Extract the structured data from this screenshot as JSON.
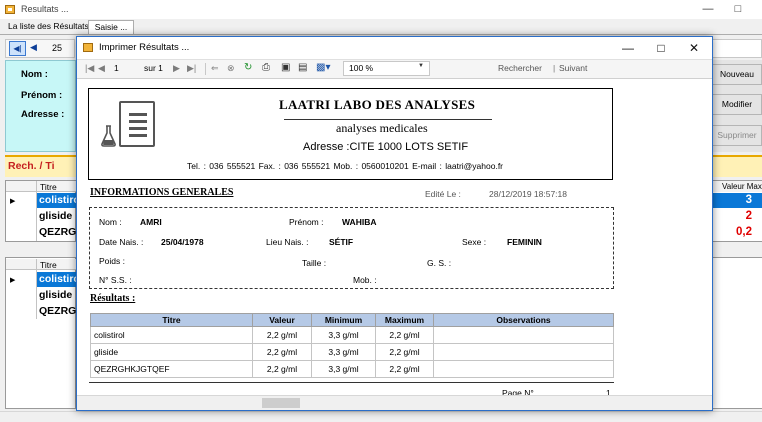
{
  "main_window": {
    "title": "Resultats ...",
    "tabs": [
      {
        "label": "La liste des Résultats"
      },
      {
        "label": "Saisie ..."
      }
    ],
    "navigator": {
      "position": "25"
    },
    "labels": {
      "nom": "Nom :",
      "prenom": "Prénom :",
      "adresse": "Adresse :"
    },
    "buttons": {
      "nouveau": "Nouveau",
      "modifier": "Modifier",
      "supprimer": "Supprimer"
    },
    "search_label": "Rech. / Ti",
    "grid1": {
      "header": "Titre",
      "rows": [
        "colistirol",
        "gliside",
        "QEZRGHKJGTQEF"
      ]
    },
    "grid_right": {
      "header": "Valeur Max",
      "values": [
        "3",
        "2",
        "0,2"
      ]
    },
    "grid2": {
      "header": "Titre",
      "rows": [
        "colistirol",
        "gliside",
        "QEZRGHKJGTQEF"
      ]
    }
  },
  "dialog": {
    "title": "Imprimer Résultats ...",
    "toolbar": {
      "page": "1",
      "of_label": "sur 1",
      "zoom": "100 %",
      "find_label": "Rechercher",
      "next_label": "Suivant"
    },
    "report": {
      "lab_name": "LAATRI LABO DES ANALYSES",
      "subtitle": "analyses medicales",
      "address": "Adresse :CITE 1000 LOTS SETIF",
      "contact": "Tel. :  036 555521 Fax. :  036 555521  Mob. : 0560010201  E-mail : laatri@yahoo.fr",
      "section_info": "INFORMATIONS GENERALES",
      "edited_label": "Edité Le :",
      "edited_value": "28/12/2019  18:57:18",
      "patient": {
        "nom_label": "Nom :",
        "nom": "AMRI",
        "prenom_label": "Prénom :",
        "prenom": "WAHIBA",
        "date_label": "Date Nais. :",
        "date": "25/04/1978",
        "lieu_label": "Lieu Nais. :",
        "lieu": "SÉTIF",
        "sexe_label": "Sexe :",
        "sexe": "FEMININ",
        "poids_label": "Poids :",
        "taille_label": "Taille :",
        "gs_label": "G. S. :",
        "nss_label": "N° S.S. :",
        "mob_label": "Mob. :"
      },
      "section_results": "Résultats :",
      "table": {
        "headers": [
          "Titre",
          "Valeur",
          "Minimum",
          "Maximum",
          "Observations"
        ],
        "rows": [
          [
            "colistirol",
            "2,2 g/ml",
            "3,3 g/ml",
            "2,2 g/ml",
            ""
          ],
          [
            "gliside",
            "2,2 g/ml",
            "3,3 g/ml",
            "2,2 g/ml",
            ""
          ],
          [
            "QEZRGHKJGTQEF",
            "2,2 g/ml",
            "3,3 g/ml",
            "2,2 g/ml",
            ""
          ]
        ]
      },
      "page_label": "Page N°",
      "page_number": "1"
    }
  },
  "colors": {
    "accent": "#0a78d7",
    "cyan_panel": "#c7f7f7",
    "yellow_bar": "#fff1b6",
    "table_header": "#b5c9e6",
    "value_red": "#e00000",
    "value_blue": "#0a78d7"
  },
  "icons": [
    "app-icon",
    "first-record-icon",
    "prev-record-icon",
    "minimize-icon",
    "maximize-icon",
    "close-icon",
    "document-icon",
    "flask-icon"
  ]
}
